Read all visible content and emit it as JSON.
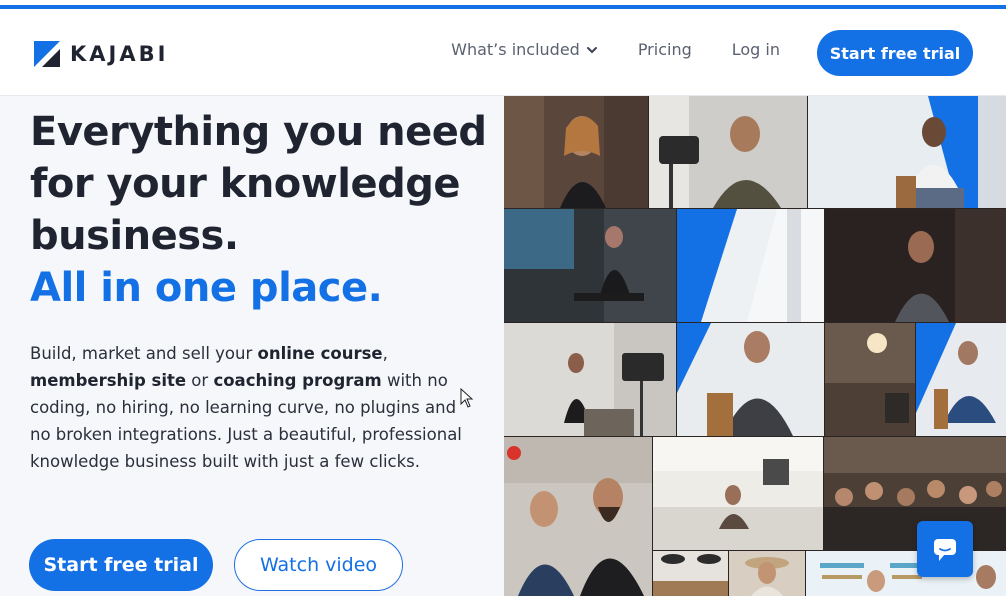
{
  "brand": {
    "name": "KAJABI",
    "accent_color": "#1470e5"
  },
  "nav": {
    "links": [
      {
        "label": "What’s included",
        "has_dropdown": true
      },
      {
        "label": "Pricing"
      },
      {
        "label": "Log in"
      }
    ],
    "cta_label": "Start free trial"
  },
  "hero": {
    "headline_lines": [
      "Everything you need",
      "for your knowledge",
      "business."
    ],
    "headline_accent": "All in one place.",
    "body": {
      "t1": "Build, market and sell your ",
      "b1": "online course",
      "t2": ",",
      "b2": "membership site",
      "t3": " or ",
      "b3": "coaching program",
      "t4": " with no coding, no hiring, no learning curve, no plugins and no broken integrations. Just a beautiful, professional knowledge business built with just a few clicks."
    },
    "primary_cta": "Start free trial",
    "secondary_cta": "Watch video"
  },
  "collage": {
    "photos": [
      "woman-smiling-photo",
      "man-seated-with-camera-photo",
      "man-speaking-on-chair-photo",
      "woman-fitness-photo",
      "blue-stripe-wall-photo",
      "man-thinking-photo",
      "woman-on-set-with-camera-photo",
      "man-interview-photo",
      "room-with-chandelier-photo",
      "man-blue-shirt-photo",
      "couple-smiling-photo",
      "kitchen-scene-photo",
      "audience-event-photo",
      "kitchen-lights-photo",
      "woman-hat-photo",
      "restore-banner-photo"
    ]
  },
  "chat": {
    "icon": "chat-bubble-icon"
  },
  "cursor": {
    "icon": "mouse-pointer-icon"
  }
}
